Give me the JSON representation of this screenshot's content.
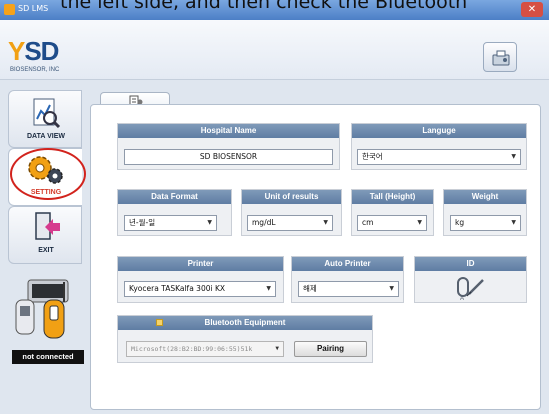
{
  "caption": "the left side, and then check the Bluetooth",
  "window": {
    "title": "SD LMS",
    "close_label": "✕"
  },
  "header": {
    "brand": "SD",
    "brand_sub": "BIOSENSOR, INC",
    "tool_icon": "device-config-icon"
  },
  "sidebar": {
    "items": [
      {
        "label": "DATA VIEW",
        "icon": "data-chart-icon"
      },
      {
        "label": "SETTING",
        "icon": "gears-icon"
      },
      {
        "label": "EXIT",
        "icon": "exit-door-icon"
      }
    ],
    "status": "not connected"
  },
  "tabs": [
    {
      "icon": "settings-tab-icon"
    }
  ],
  "hospital": {
    "header": "Hospital Name",
    "value": "SD BIOSENSOR"
  },
  "language": {
    "header": "Languge",
    "value": "한국어"
  },
  "date_format": {
    "header": "Data Format",
    "value": "년-월-일"
  },
  "units": {
    "header": "Unit of results",
    "value": "mg/dL"
  },
  "height": {
    "header": "Tall (Height)",
    "value": "cm"
  },
  "weight": {
    "header": "Weight",
    "value": "kg"
  },
  "printer": {
    "header": "Printer",
    "value": "Kyocera TASKalfa 300i KX"
  },
  "auto_printer": {
    "header": "Auto Printer",
    "value": "해제"
  },
  "id": {
    "header": "ID",
    "icon": "id-signature-icon"
  },
  "bluetooth": {
    "header": "Bluetooth Equipment",
    "value": "Microsoft(28:B2:BD:99:06:55)51k",
    "pair_label": "Pairing"
  },
  "colors": {
    "accent_header": "#6a87ad",
    "highlight_circle": "#d2231d",
    "setting_label": "#d43b2a"
  }
}
